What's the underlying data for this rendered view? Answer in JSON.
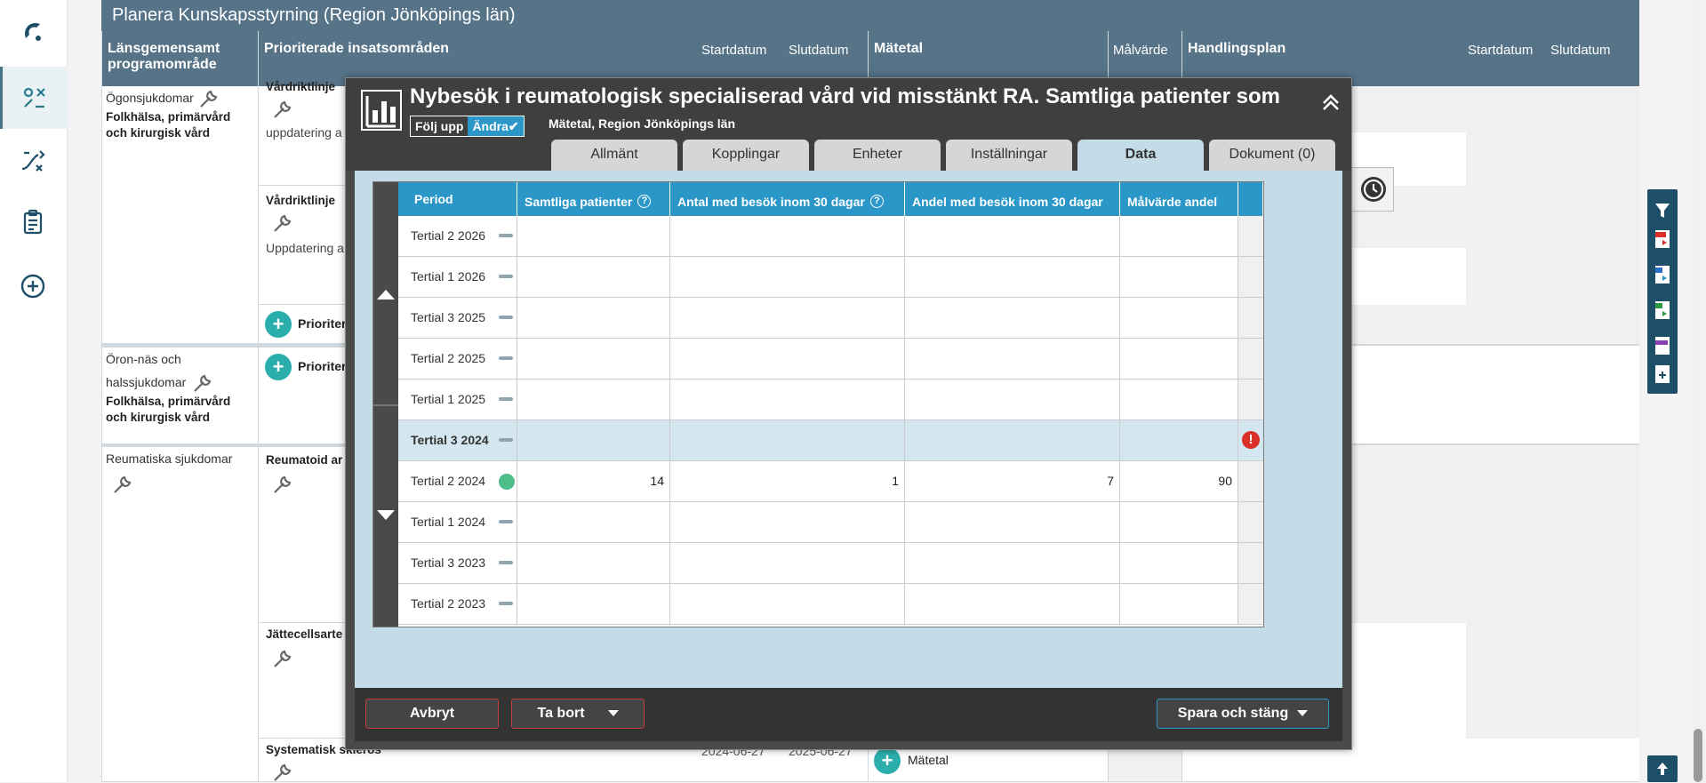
{
  "page_title": "Planera Kunskapsstyrning (Region Jönköpings län)",
  "columns": {
    "program": "Länsgemensamt programområde",
    "priority": "Prioriterade insatsområden",
    "start": "Startdatum",
    "end": "Slutdatum",
    "metric": "Mätetal",
    "target": "Målvärde",
    "plan": "Handlingsplan",
    "plan_start": "Startdatum",
    "plan_end": "Slutdatum"
  },
  "left_rows": {
    "r1_name": "Ögonsjukdomar",
    "r1_group": "Folkhälsa, primärvård och kirurgisk vård",
    "r1_c1": "Vårdriktlinje",
    "r1_c1_text": "uppdatering a",
    "r1_c2": "Vårdriktlinje",
    "r1_c2_text": "Uppdatering a",
    "r1_add": "Prioriter",
    "r2_name_a": "Öron-näs och",
    "r2_name_b": "halssjukdomar",
    "r2_group": "Folkhälsa, primärvård och kirurgisk vård",
    "r2_add": "Prioriter",
    "r3_name": "Reumatiska sjukdomar",
    "r3_c1": "Reumatoid ar",
    "r3_c2": "Jättecellsarte",
    "r3_c3": "Systematisk skleros",
    "r3_c3_start": "2024-06-27",
    "r3_c3_end": "2025-06-27",
    "r3_metric_add": "Mätetal"
  },
  "modal": {
    "title": "Nybesök i reumatologisk specialiserad vård vid misstänkt RA. Samtliga patienter som",
    "subtitle": "Mätetal, Region Jönköpings län",
    "toggle_follow": "Följ upp",
    "toggle_edit": "Ändra✔",
    "tabs": [
      "Allmänt",
      "Kopplingar",
      "Enheter",
      "Inställningar",
      "Data",
      "Dokument (0)"
    ],
    "active_tab": "Data",
    "grid_headers": [
      "Period",
      "Samtliga patienter",
      "Antal med besök inom 30 dagar",
      "Andel med besök inom 30 dagar",
      "Målvärde andel"
    ],
    "rows": [
      {
        "period": "Tertial 2 2026",
        "a": "",
        "b": "",
        "c": "",
        "d": ""
      },
      {
        "period": "Tertial 1 2026",
        "a": "",
        "b": "",
        "c": "",
        "d": ""
      },
      {
        "period": "Tertial 3 2025",
        "a": "",
        "b": "",
        "c": "",
        "d": ""
      },
      {
        "period": "Tertial 2 2025",
        "a": "",
        "b": "",
        "c": "",
        "d": ""
      },
      {
        "period": "Tertial 1 2025",
        "a": "",
        "b": "",
        "c": "",
        "d": ""
      },
      {
        "period": "Tertial 3 2024",
        "a": "",
        "b": "",
        "c": "",
        "d": ""
      },
      {
        "period": "Tertial 2 2024",
        "a": "14",
        "b": "1",
        "c": "7",
        "d": "90"
      },
      {
        "period": "Tertial 1 2024",
        "a": "",
        "b": "",
        "c": "",
        "d": ""
      },
      {
        "period": "Tertial 3 2023",
        "a": "",
        "b": "",
        "c": "",
        "d": ""
      },
      {
        "period": "Tertial 2 2023",
        "a": "",
        "b": "",
        "c": "",
        "d": ""
      }
    ],
    "error_mark": "!",
    "btn_cancel": "Avbryt",
    "btn_delete": "Ta bort",
    "btn_save": "Spara och stäng"
  },
  "colors": {
    "header": "#567388",
    "accent": "#2b97c8",
    "add": "#2aaeab",
    "error": "#d9302a",
    "status_ok": "#4dbd8a"
  }
}
